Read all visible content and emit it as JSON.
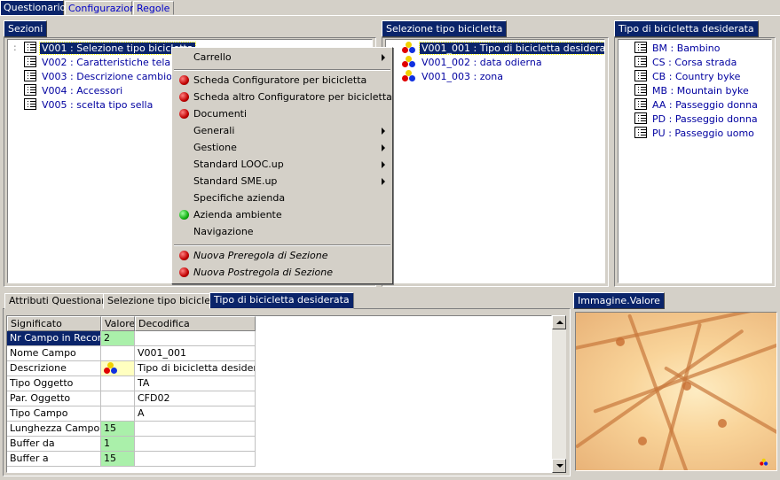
{
  "tabs": [
    "Questionario",
    "Configurazioni",
    "Regole"
  ],
  "panels": {
    "sezioni": {
      "caption": "Sezioni",
      "items": [
        {
          "code": "V001",
          "label": "Selezione tipo bicicletta"
        },
        {
          "code": "V002",
          "label": "Caratteristiche telaio"
        },
        {
          "code": "V003",
          "label": "Descrizione cambio"
        },
        {
          "code": "V004",
          "label": "Accessori"
        },
        {
          "code": "V005",
          "label": "scelta tipo sella"
        }
      ]
    },
    "selezione": {
      "caption": "Selezione tipo bicicletta",
      "items": [
        {
          "code": "V001_001",
          "label": "Tipo di bicicletta desiderata"
        },
        {
          "code": "V001_002",
          "label": "data odierna"
        },
        {
          "code": "V001_003",
          "label": "zona"
        }
      ]
    },
    "tipo": {
      "caption": "Tipo di bicicletta desiderata",
      "items": [
        {
          "code": "BM",
          "label": "Bambino"
        },
        {
          "code": "CS",
          "label": "Corsa strada"
        },
        {
          "code": "CB",
          "label": "Country byke"
        },
        {
          "code": "MB",
          "label": "Mountain byke"
        },
        {
          "code": "AA",
          "label": "Passeggio donna"
        },
        {
          "code": "PD",
          "label": "Passeggio donna"
        },
        {
          "code": "PU",
          "label": "Passeggio uomo"
        }
      ]
    }
  },
  "separator": ":",
  "context_menu": {
    "items": [
      {
        "label": "Carrello",
        "submenu": true
      },
      {
        "label": "Scheda Configuratore per bicicletta",
        "dot": "red"
      },
      {
        "label": "Scheda altro Configuratore per bicicletta",
        "dot": "red"
      },
      {
        "label": "Documenti",
        "dot": "red"
      },
      {
        "label": "Generali",
        "submenu": true
      },
      {
        "label": "Gestione",
        "submenu": true
      },
      {
        "label": "Standard LOOC.up",
        "submenu": true
      },
      {
        "label": "Standard SME.up",
        "submenu": true
      },
      {
        "label": "Specifiche azienda"
      },
      {
        "label": "Azienda ambiente",
        "dot": "green"
      },
      {
        "label": "Navigazione"
      },
      {
        "label": "Nuova Preregola di Sezione",
        "dot": "red",
        "italic": true
      },
      {
        "label": "Nuova Postregola di Sezione",
        "dot": "red",
        "italic": true
      }
    ]
  },
  "bottom_tabs": [
    "Attributi Questionario",
    "Selezione tipo bicicletta",
    "Tipo di bicicletta desiderata"
  ],
  "image_caption": "Immagine.Valore",
  "table": {
    "headers": [
      "Significato",
      "Valore",
      "Decodifica"
    ],
    "rows": [
      {
        "significato": "Nr Campo in Record",
        "valore": "2",
        "decodifica": ""
      },
      {
        "significato": "Nome Campo",
        "valore": "",
        "decodifica": "V001_001"
      },
      {
        "significato": "Descrizione",
        "valore": "",
        "decodifica": "Tipo di bicicletta desiderata"
      },
      {
        "significato": "Tipo Oggetto",
        "valore": "",
        "decodifica": "TA"
      },
      {
        "significato": "Par. Oggetto",
        "valore": "",
        "decodifica": "CFD02"
      },
      {
        "significato": "Tipo Campo",
        "valore": "",
        "decodifica": "A"
      },
      {
        "significato": "Lunghezza Campo",
        "valore": "15",
        "decodifica": ""
      },
      {
        "significato": "Buffer da",
        "valore": "1",
        "decodifica": ""
      },
      {
        "significato": "Buffer a",
        "valore": "15",
        "decodifica": ""
      }
    ]
  },
  "colors": {
    "selection": "#0a246a",
    "value_green": "#aaf0aa",
    "link_blue": "#0000a0"
  }
}
